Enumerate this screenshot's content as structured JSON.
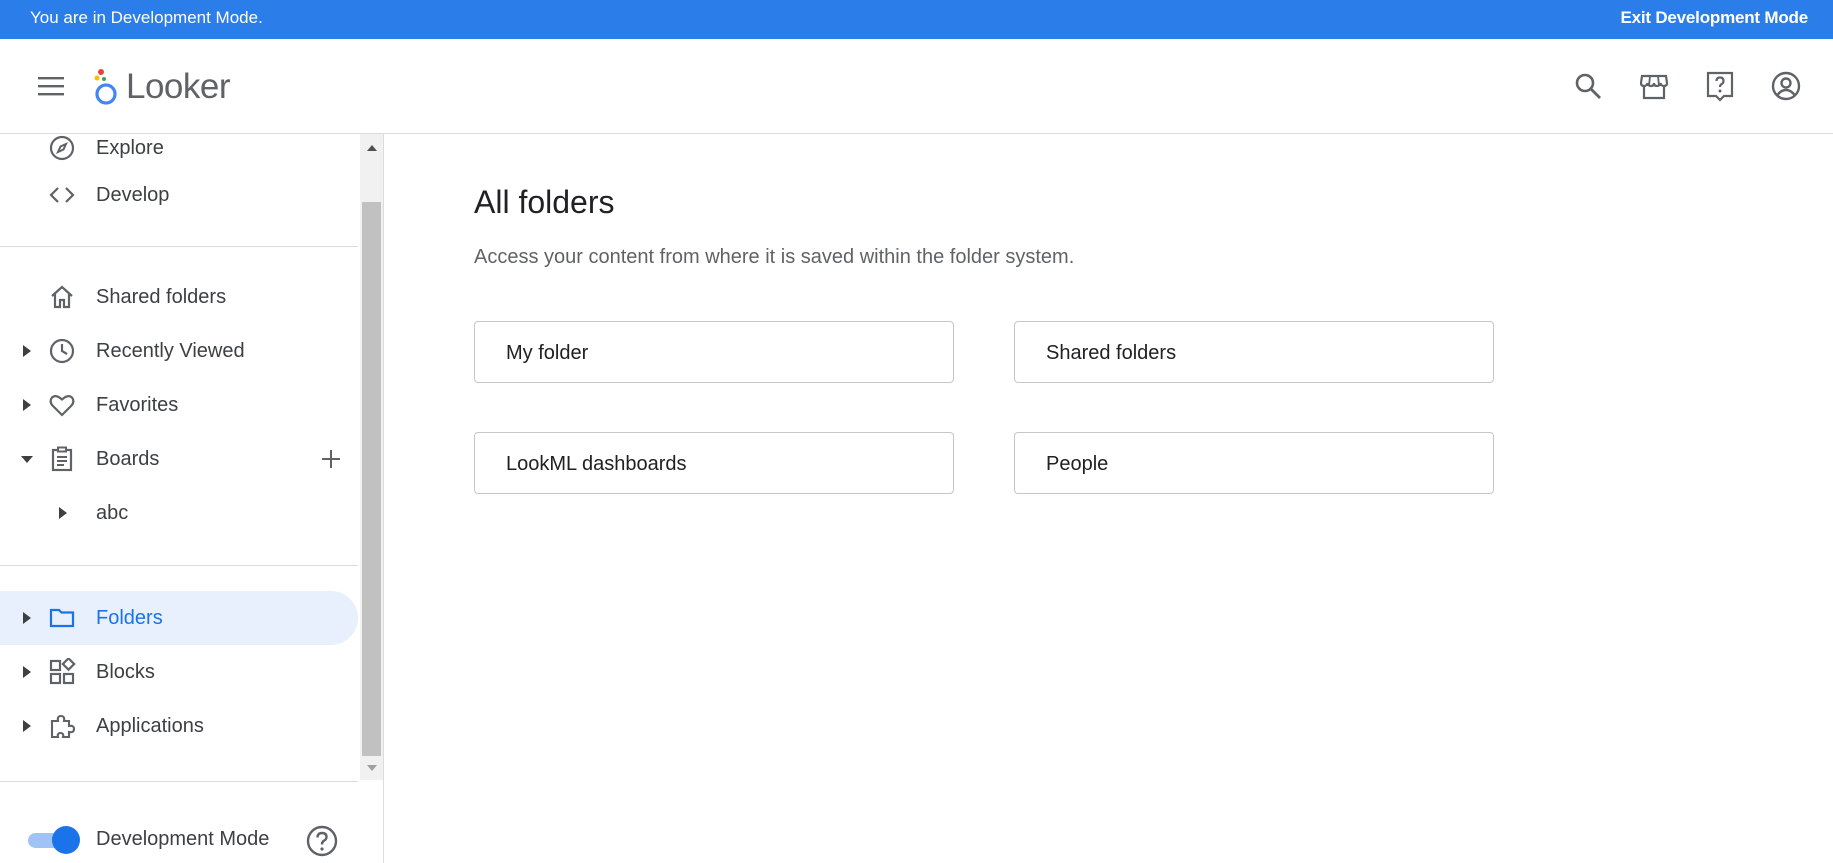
{
  "devbar": {
    "message": "You are in Development Mode.",
    "exit_label": "Exit Development Mode"
  },
  "header": {
    "app_name": "Looker",
    "icons": [
      "menu-icon",
      "search-icon",
      "marketplace-icon",
      "help-icon",
      "account-icon"
    ]
  },
  "sidebar": {
    "items": [
      {
        "label": "Explore",
        "icon": "compass-icon"
      },
      {
        "label": "Develop",
        "icon": "code-icon"
      },
      {
        "label": "Shared folders",
        "icon": "home-icon"
      },
      {
        "label": "Recently Viewed",
        "icon": "clock-icon"
      },
      {
        "label": "Favorites",
        "icon": "heart-icon"
      },
      {
        "label": "Boards",
        "icon": "clipboard-icon"
      },
      {
        "label": "abc"
      },
      {
        "label": "Folders",
        "icon": "folder-icon",
        "active": true
      },
      {
        "label": "Blocks",
        "icon": "blocks-icon"
      },
      {
        "label": "Applications",
        "icon": "puzzle-icon"
      }
    ],
    "dev_mode_label": "Development Mode",
    "dev_mode_on": true
  },
  "main": {
    "title": "All folders",
    "subtitle": "Access your content from where it is saved within the folder system.",
    "cards": [
      {
        "label": "My folder"
      },
      {
        "label": "Shared folders"
      },
      {
        "label": "LookML dashboards"
      },
      {
        "label": "People"
      }
    ]
  },
  "colors": {
    "accent": "#1a73e8",
    "devbar": "#2b7de9",
    "active_bg": "#e8f0fe"
  }
}
